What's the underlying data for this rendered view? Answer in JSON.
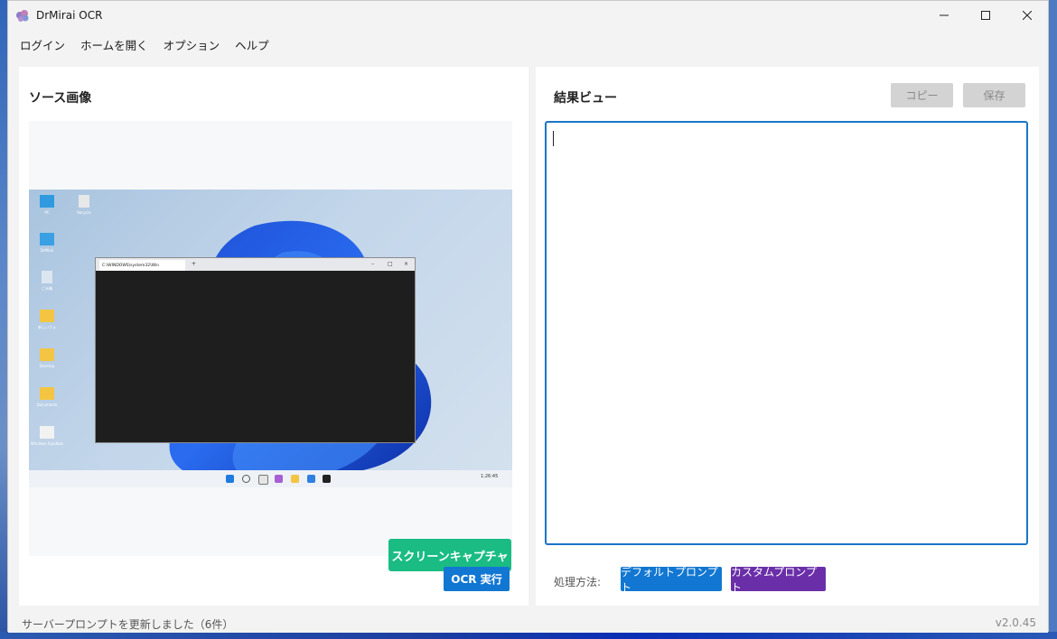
{
  "window": {
    "title": "DrMirai OCR"
  },
  "menu": {
    "items": [
      "ログイン",
      "ホームを開く",
      "オプション",
      "ヘルプ"
    ]
  },
  "left_panel": {
    "title": "ソース画像",
    "capture_button": "スクリーンキャプチャ",
    "ocr_button": "OCR 実行",
    "screenshot": {
      "terminal_tab": "C:\\WINDOWS\\system32\\Win",
      "tray_time": "1:26:45",
      "desktop_icons": [
        "PC",
        "Recycle",
        "DrMirai",
        "ごみ箱",
        "新しいフォ",
        "Desktop",
        "Documents",
        "Windows Sandbox"
      ]
    }
  },
  "right_panel": {
    "title": "結果ビュー",
    "copy_button": "コピー",
    "save_button": "保存",
    "result_text": "",
    "processing_label": "処理方法:",
    "default_prompt_button": "デフォルトプロンプト",
    "custom_prompt_button": "カスタムプロンプト"
  },
  "status": {
    "message": "サーバープロンプトを更新しました（6件）",
    "version": "v2.0.45"
  },
  "colors": {
    "capture_green": "#1abc84",
    "primary_blue": "#1277d2",
    "custom_purple": "#6a2fa8",
    "disabled_gray": "#d3d3d3"
  }
}
